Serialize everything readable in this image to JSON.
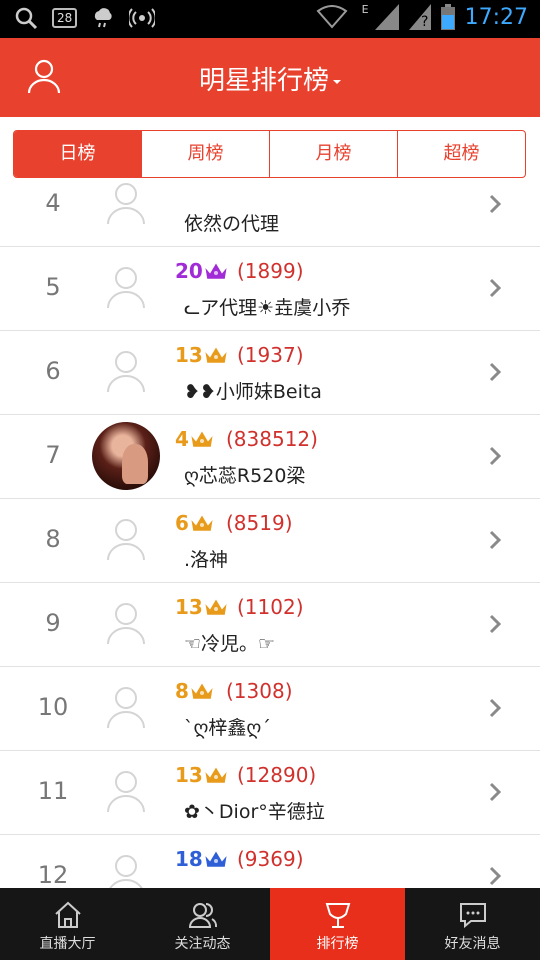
{
  "status_bar": {
    "badge": "28",
    "network": "E",
    "time": "17:27"
  },
  "header": {
    "title": "明星排行榜"
  },
  "tabs": [
    {
      "label": "日榜",
      "active": true
    },
    {
      "label": "周榜",
      "active": false
    },
    {
      "label": "月榜",
      "active": false
    },
    {
      "label": "超榜",
      "active": false
    }
  ],
  "rows": [
    {
      "rank": "4",
      "level": "",
      "score": "",
      "name": "依然の代理",
      "avatar": "placeholder",
      "level_color": "#2f5fd6"
    },
    {
      "rank": "5",
      "level": "20",
      "score": "(1899)",
      "name": "ᓚア代理☀垚虞小乔",
      "avatar": "placeholder",
      "level_color": "#a12bd6"
    },
    {
      "rank": "6",
      "level": "13",
      "score": "(1937)",
      "name": "❥❥小师妹Beita",
      "avatar": "placeholder",
      "level_color": "#e89a1a"
    },
    {
      "rank": "7",
      "level": "4",
      "score": "(838512)",
      "name": "ღ芯蕊R520梁",
      "avatar": "photo",
      "level_color": "#e89a1a"
    },
    {
      "rank": "8",
      "level": "6",
      "score": "(8519)",
      "name": ".洛神",
      "avatar": "placeholder",
      "level_color": "#e89a1a"
    },
    {
      "rank": "9",
      "level": "13",
      "score": "(1102)",
      "name": "☜冷児。☞",
      "avatar": "placeholder",
      "level_color": "#e89a1a"
    },
    {
      "rank": "10",
      "level": "8",
      "score": "(1308)",
      "name": "ˋღ梓鑫ღˊ",
      "avatar": "placeholder",
      "level_color": "#e89a1a"
    },
    {
      "rank": "11",
      "level": "13",
      "score": "(12890)",
      "name": "✿丶Dior°辛德拉",
      "avatar": "placeholder",
      "level_color": "#e89a1a"
    },
    {
      "rank": "12",
      "level": "18",
      "score": "(9369)",
      "name": "",
      "avatar": "placeholder",
      "level_color": "#2f5fd6"
    }
  ],
  "bottom_nav": [
    {
      "label": "直播大厅",
      "icon": "home-icon",
      "active": false
    },
    {
      "label": "关注动态",
      "icon": "users-icon",
      "active": false
    },
    {
      "label": "排行榜",
      "icon": "trophy-icon",
      "active": true
    },
    {
      "label": "好友消息",
      "icon": "message-icon",
      "active": false
    }
  ],
  "colors": {
    "accent": "#e8422f",
    "score": "#d0312d",
    "nav_bg": "#161616",
    "nav_active": "#e82f1c",
    "time": "#3da9ff"
  }
}
